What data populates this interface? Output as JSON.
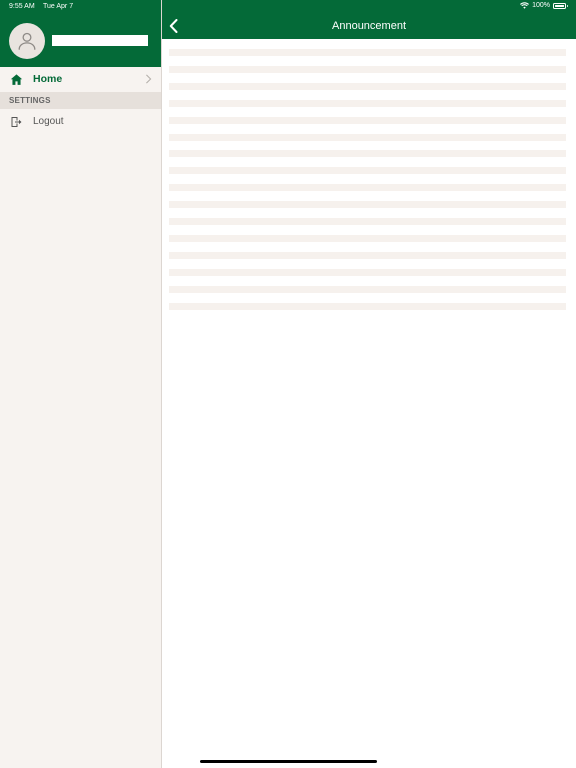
{
  "status_bar": {
    "time": "9:55 AM",
    "date": "Tue Apr 7",
    "battery": "100%",
    "battery_level": 1.0,
    "icons": [
      "wifi-icon",
      "battery-icon"
    ]
  },
  "sidebar": {
    "avatar_icon": "user-icon",
    "items": [
      {
        "label": "Home",
        "icon": "home-icon",
        "active": true
      },
      {
        "label": "Logout",
        "icon": "logout-icon"
      }
    ],
    "sections": [
      {
        "label": "SETTINGS"
      }
    ]
  },
  "navbar": {
    "title": "Announcement",
    "back_icon": "chevron-left-icon"
  },
  "content": {
    "placeholder_rows": 16
  },
  "colors": {
    "brand": "#046a38",
    "sidebar_bg": "#f7f3f0",
    "section_bg": "#e6e0db",
    "skeleton": "#f6f1ed"
  }
}
